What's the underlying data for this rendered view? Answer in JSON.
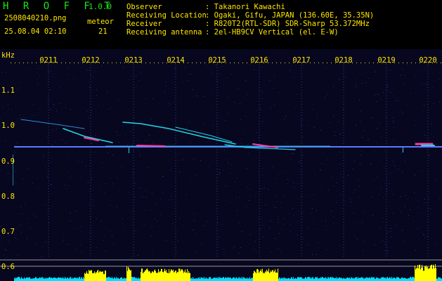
{
  "header": {
    "title": "H R O F F T",
    "version": "1.0.0",
    "filename": "2508040210.png",
    "timestamp": "25.08.04 02:10",
    "meteor_label": "meteor",
    "meteor_count": "21",
    "info": [
      {
        "key": "Observer",
        "value": ": Takanori Kawachi"
      },
      {
        "key": "Receiving Location",
        "value": ": Ogaki, Gifu, JAPAN (136.60E, 35.35N)"
      },
      {
        "key": "Receiver",
        "value": ": R820T2(RTL-SDR) SDR-Sharp 53.372MHz"
      },
      {
        "key": "Receiving antenna",
        "value": ": 2el-HB9CV Vertical (el. E-W)"
      }
    ]
  },
  "spectrogram": {
    "y_unit": "kHz",
    "time_labels": [
      "0211",
      "0212",
      "0213",
      "0214",
      "0215",
      "0216",
      "0217",
      "0218",
      "0219",
      "0220"
    ],
    "freq_labels": [
      "1.1",
      "1.0",
      "0.9",
      "0.8",
      "0.7",
      "0.6"
    ],
    "colors": {
      "background": "#07071f",
      "text": "#ffe600",
      "title": "#19e619",
      "carrier": "#5a7bff",
      "echo": "#22d6ea",
      "echo_hot": "#ff3fa0",
      "activity_base": "#00e0ff",
      "activity_peak": "#ffff00"
    }
  }
}
